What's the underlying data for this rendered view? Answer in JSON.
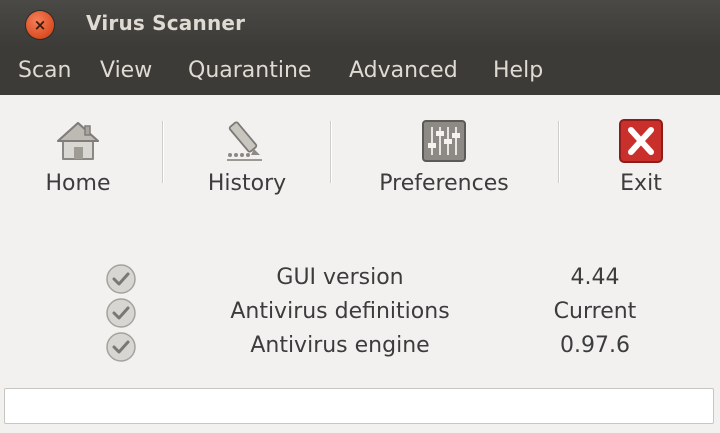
{
  "window": {
    "title": "Virus Scanner",
    "close_glyph": "×"
  },
  "menubar": {
    "items": [
      {
        "label": "Scan"
      },
      {
        "label": "View"
      },
      {
        "label": "Quarantine"
      },
      {
        "label": "Advanced"
      },
      {
        "label": "Help"
      }
    ]
  },
  "toolbar": {
    "home_label": "Home",
    "history_label": "History",
    "preferences_label": "Preferences",
    "exit_label": "Exit",
    "icons": [
      "home-icon",
      "history-icon",
      "preferences-icon",
      "exit-icon"
    ]
  },
  "info": {
    "rows": [
      {
        "label": "GUI version",
        "value": "4.44"
      },
      {
        "label": "Antivirus definitions",
        "value": "Current"
      },
      {
        "label": "Antivirus engine",
        "value": "0.97.6"
      }
    ]
  },
  "statusbar": {
    "text": ""
  },
  "colors": {
    "titlebar": "#3c3b37",
    "close_button": "#e0542a",
    "exit_icon": "#c9302c",
    "text": "#3c3c3c"
  }
}
